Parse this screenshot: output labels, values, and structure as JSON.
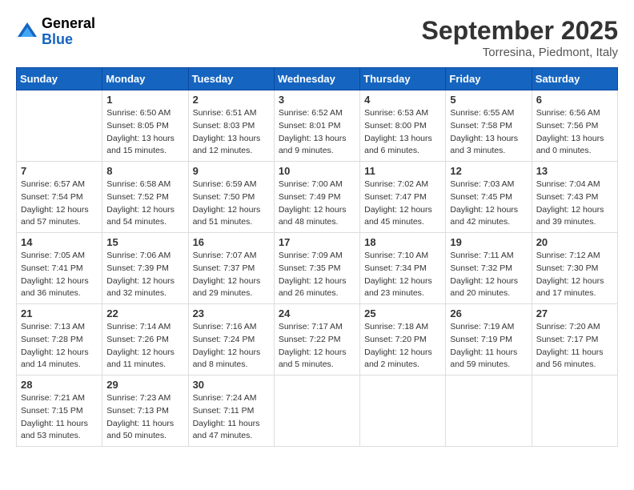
{
  "header": {
    "logo": {
      "general": "General",
      "blue": "Blue"
    },
    "title": "September 2025",
    "location": "Torresina, Piedmont, Italy"
  },
  "calendar": {
    "days_of_week": [
      "Sunday",
      "Monday",
      "Tuesday",
      "Wednesday",
      "Thursday",
      "Friday",
      "Saturday"
    ],
    "weeks": [
      [
        {
          "day": "",
          "info": ""
        },
        {
          "day": "1",
          "info": "Sunrise: 6:50 AM\nSunset: 8:05 PM\nDaylight: 13 hours\nand 15 minutes."
        },
        {
          "day": "2",
          "info": "Sunrise: 6:51 AM\nSunset: 8:03 PM\nDaylight: 13 hours\nand 12 minutes."
        },
        {
          "day": "3",
          "info": "Sunrise: 6:52 AM\nSunset: 8:01 PM\nDaylight: 13 hours\nand 9 minutes."
        },
        {
          "day": "4",
          "info": "Sunrise: 6:53 AM\nSunset: 8:00 PM\nDaylight: 13 hours\nand 6 minutes."
        },
        {
          "day": "5",
          "info": "Sunrise: 6:55 AM\nSunset: 7:58 PM\nDaylight: 13 hours\nand 3 minutes."
        },
        {
          "day": "6",
          "info": "Sunrise: 6:56 AM\nSunset: 7:56 PM\nDaylight: 13 hours\nand 0 minutes."
        }
      ],
      [
        {
          "day": "7",
          "info": "Sunrise: 6:57 AM\nSunset: 7:54 PM\nDaylight: 12 hours\nand 57 minutes."
        },
        {
          "day": "8",
          "info": "Sunrise: 6:58 AM\nSunset: 7:52 PM\nDaylight: 12 hours\nand 54 minutes."
        },
        {
          "day": "9",
          "info": "Sunrise: 6:59 AM\nSunset: 7:50 PM\nDaylight: 12 hours\nand 51 minutes."
        },
        {
          "day": "10",
          "info": "Sunrise: 7:00 AM\nSunset: 7:49 PM\nDaylight: 12 hours\nand 48 minutes."
        },
        {
          "day": "11",
          "info": "Sunrise: 7:02 AM\nSunset: 7:47 PM\nDaylight: 12 hours\nand 45 minutes."
        },
        {
          "day": "12",
          "info": "Sunrise: 7:03 AM\nSunset: 7:45 PM\nDaylight: 12 hours\nand 42 minutes."
        },
        {
          "day": "13",
          "info": "Sunrise: 7:04 AM\nSunset: 7:43 PM\nDaylight: 12 hours\nand 39 minutes."
        }
      ],
      [
        {
          "day": "14",
          "info": "Sunrise: 7:05 AM\nSunset: 7:41 PM\nDaylight: 12 hours\nand 36 minutes."
        },
        {
          "day": "15",
          "info": "Sunrise: 7:06 AM\nSunset: 7:39 PM\nDaylight: 12 hours\nand 32 minutes."
        },
        {
          "day": "16",
          "info": "Sunrise: 7:07 AM\nSunset: 7:37 PM\nDaylight: 12 hours\nand 29 minutes."
        },
        {
          "day": "17",
          "info": "Sunrise: 7:09 AM\nSunset: 7:35 PM\nDaylight: 12 hours\nand 26 minutes."
        },
        {
          "day": "18",
          "info": "Sunrise: 7:10 AM\nSunset: 7:34 PM\nDaylight: 12 hours\nand 23 minutes."
        },
        {
          "day": "19",
          "info": "Sunrise: 7:11 AM\nSunset: 7:32 PM\nDaylight: 12 hours\nand 20 minutes."
        },
        {
          "day": "20",
          "info": "Sunrise: 7:12 AM\nSunset: 7:30 PM\nDaylight: 12 hours\nand 17 minutes."
        }
      ],
      [
        {
          "day": "21",
          "info": "Sunrise: 7:13 AM\nSunset: 7:28 PM\nDaylight: 12 hours\nand 14 minutes."
        },
        {
          "day": "22",
          "info": "Sunrise: 7:14 AM\nSunset: 7:26 PM\nDaylight: 12 hours\nand 11 minutes."
        },
        {
          "day": "23",
          "info": "Sunrise: 7:16 AM\nSunset: 7:24 PM\nDaylight: 12 hours\nand 8 minutes."
        },
        {
          "day": "24",
          "info": "Sunrise: 7:17 AM\nSunset: 7:22 PM\nDaylight: 12 hours\nand 5 minutes."
        },
        {
          "day": "25",
          "info": "Sunrise: 7:18 AM\nSunset: 7:20 PM\nDaylight: 12 hours\nand 2 minutes."
        },
        {
          "day": "26",
          "info": "Sunrise: 7:19 AM\nSunset: 7:19 PM\nDaylight: 11 hours\nand 59 minutes."
        },
        {
          "day": "27",
          "info": "Sunrise: 7:20 AM\nSunset: 7:17 PM\nDaylight: 11 hours\nand 56 minutes."
        }
      ],
      [
        {
          "day": "28",
          "info": "Sunrise: 7:21 AM\nSunset: 7:15 PM\nDaylight: 11 hours\nand 53 minutes."
        },
        {
          "day": "29",
          "info": "Sunrise: 7:23 AM\nSunset: 7:13 PM\nDaylight: 11 hours\nand 50 minutes."
        },
        {
          "day": "30",
          "info": "Sunrise: 7:24 AM\nSunset: 7:11 PM\nDaylight: 11 hours\nand 47 minutes."
        },
        {
          "day": "",
          "info": ""
        },
        {
          "day": "",
          "info": ""
        },
        {
          "day": "",
          "info": ""
        },
        {
          "day": "",
          "info": ""
        }
      ]
    ]
  }
}
